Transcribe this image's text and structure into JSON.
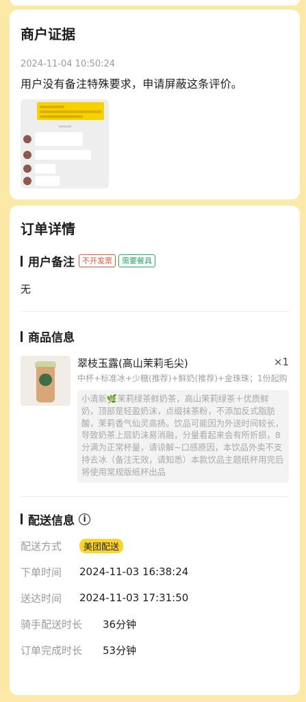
{
  "merchant_evidence": {
    "title": "商户证据",
    "time": "2024-11-04 10:50:24",
    "text": "用户没有备注特殊要求，申请屏蔽这条评价。"
  },
  "order_detail": {
    "title": "订单详情",
    "remark_section": {
      "title": "用户备注",
      "tags": [
        "不开发票",
        "需要餐具"
      ],
      "value": "无"
    },
    "goods_section": {
      "title": "商品信息",
      "item": {
        "name": "翠枝玉露(高山茉莉毛尖)",
        "qty": "×1",
        "spec": "中杯+标准冰+少糖(推荐)+鲜奶(推荐)+金珠珠；1份起购",
        "description": "小清新🌿茉莉绿茶鲜奶茶，高山茉莉绿茶＋优质鲜奶，顶部是轻盈奶沫，点缀抹茶粉，不添加反式脂肪酸，茉莉香气仙灵高扬。饮品可能因为外送时间较长，导致奶茶上层奶沫易消融，分量看起来会有所折损，8分满为正常杯量，请谅解~口感原因，本饮品外卖不支持去冰（备注无效，请知悉）本款饮品主题纸杯用完后将使用常规版纸杯出品"
      }
    },
    "delivery_section": {
      "title": "配送信息",
      "info_icon": "info-circle-icon",
      "rows": [
        {
          "key": "配送方式",
          "value": "美团配送"
        },
        {
          "key": "下单时间",
          "value": "2024-11-03 16:38:24"
        },
        {
          "key": "送达时间",
          "value": "2024-11-03 17:31:50"
        },
        {
          "key": "骑手配送时长",
          "value": "36分钟"
        },
        {
          "key": "订单完成时长",
          "value": "53分钟"
        }
      ]
    }
  },
  "colors": {
    "page_bg": "#fde9a7",
    "tag_red": "#e0553d",
    "tag_green": "#2fa56a",
    "delivery_badge": "#fbd52d"
  }
}
